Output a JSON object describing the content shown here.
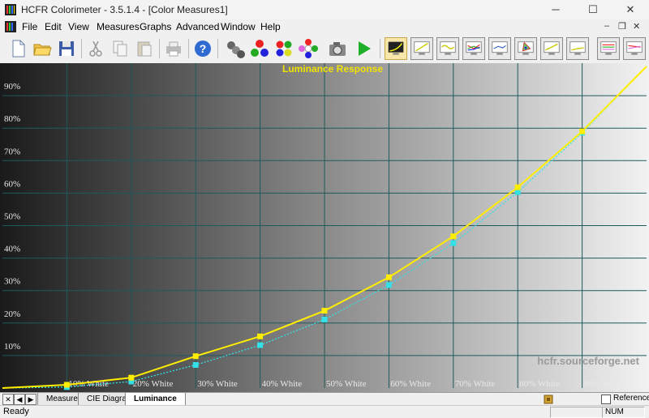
{
  "window": {
    "title": "HCFR Colorimeter - 3.5.1.4 - [Color Measures1]",
    "controls": {
      "minimize": "─",
      "maximize": "☐",
      "close": "✕"
    }
  },
  "menu": {
    "items": [
      {
        "label": "File",
        "name": "menu-file"
      },
      {
        "label": "Edit",
        "name": "menu-edit"
      },
      {
        "label": "View",
        "name": "menu-view"
      },
      {
        "label": "Measures",
        "name": "menu-measures"
      },
      {
        "label": "Graphs",
        "name": "menu-graphs"
      },
      {
        "label": "Advanced",
        "name": "menu-advanced"
      },
      {
        "label": "Window",
        "name": "menu-window"
      },
      {
        "label": "Help",
        "name": "menu-help"
      }
    ],
    "mdi": {
      "minimize": "–",
      "restore": "❐",
      "close": "✕"
    }
  },
  "toolbar": {
    "icons": [
      "new-file-icon",
      "open-folder-icon",
      "save-disk-icon",
      "cut-scissors-icon",
      "copy-icon",
      "paste-icon",
      "print-icon",
      "help-icon",
      "sensor-icon",
      "color-spheres-icon",
      "measure-colors-icon",
      "multi-color-icon",
      "camera-icon",
      "play-icon",
      "luminance-graph-icon",
      "gamma-graph-icon",
      "rgb-graph-icon",
      "multi-rgb-graph-icon",
      "color-temp-graph-icon",
      "cie-diagram-icon",
      "saturation-graph-icon",
      "near-black-graph-icon",
      "near-white-graph-icon",
      "saturation-shift-graph-icon"
    ]
  },
  "chart_data": {
    "type": "line",
    "title": "Luminance Response",
    "watermark": "hcfr.sourceforge.net",
    "x": [
      0,
      10,
      20,
      30,
      40,
      50,
      60,
      70,
      80,
      90,
      100
    ],
    "x_tick_labels": [
      "10% White",
      "20% White",
      "30% White",
      "40% White",
      "50% White",
      "60% White",
      "70% White",
      "80% White",
      "90% White"
    ],
    "y_tick_labels": [
      "10%",
      "20%",
      "30%",
      "40%",
      "50%",
      "60%",
      "70%",
      "80%",
      "90%"
    ],
    "xlim": [
      0,
      100
    ],
    "ylim": [
      0,
      100
    ],
    "grid": true,
    "series": [
      {
        "values": [
          0,
          1.0,
          3.2,
          9.8,
          15.9,
          23.8,
          34.1,
          46.7,
          61.8,
          79.0,
          99.0
        ],
        "color": "#ffee00",
        "style": "solid"
      },
      {
        "values": [
          0,
          0.3,
          2.0,
          7.1,
          13.2,
          21.1,
          31.7,
          44.6,
          60.3,
          78.6,
          99.0
        ],
        "color": "#33e0e8",
        "style": "dotted"
      }
    ]
  },
  "tabs": [
    {
      "label": "Measures",
      "name": "tab-measures",
      "active": false
    },
    {
      "label": "CIE Diagram",
      "name": "tab-cie-diagram",
      "active": false
    },
    {
      "label": "Luminance",
      "name": "tab-luminance",
      "active": true
    }
  ],
  "tab_nav": {
    "first": "✕",
    "prev": "◀",
    "next": "▶"
  },
  "reference": {
    "label": "Reference"
  },
  "status": {
    "text": "Ready",
    "num": "NUM"
  }
}
